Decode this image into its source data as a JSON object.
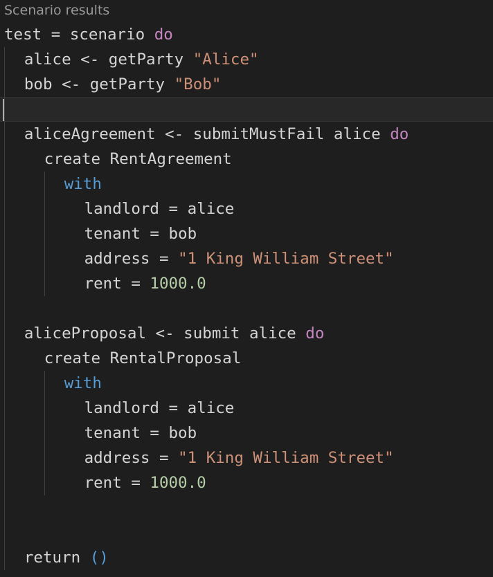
{
  "codelens": {
    "label": "Scenario results"
  },
  "lines": [
    {
      "indent": 0,
      "tokens": [
        {
          "t": "test = scenario ",
          "c": ""
        },
        {
          "t": "do",
          "c": "kw"
        }
      ]
    },
    {
      "indent": 1,
      "tokens": [
        {
          "t": "alice <- getParty ",
          "c": ""
        },
        {
          "t": "\"Alice\"",
          "c": "str"
        }
      ]
    },
    {
      "indent": 1,
      "tokens": [
        {
          "t": "bob <- getParty ",
          "c": ""
        },
        {
          "t": "\"Bob\"",
          "c": "str"
        }
      ]
    },
    {
      "indent": 0,
      "current": true,
      "tokens": []
    },
    {
      "indent": 1,
      "tokens": [
        {
          "t": "aliceAgreement <- submitMustFail alice ",
          "c": ""
        },
        {
          "t": "do",
          "c": "kw"
        }
      ]
    },
    {
      "indent": 2,
      "tokens": [
        {
          "t": "create RentAgreement",
          "c": ""
        }
      ]
    },
    {
      "indent": 3,
      "tokens": [
        {
          "t": "with",
          "c": "kw2"
        }
      ]
    },
    {
      "indent": 4,
      "tokens": [
        {
          "t": "landlord = alice",
          "c": ""
        }
      ]
    },
    {
      "indent": 4,
      "tokens": [
        {
          "t": "tenant = bob",
          "c": ""
        }
      ]
    },
    {
      "indent": 4,
      "tokens": [
        {
          "t": "address = ",
          "c": ""
        },
        {
          "t": "\"1 King William Street\"",
          "c": "str"
        }
      ]
    },
    {
      "indent": 4,
      "tokens": [
        {
          "t": "rent = ",
          "c": ""
        },
        {
          "t": "1000.0",
          "c": "num"
        }
      ]
    },
    {
      "indent": 0,
      "tokens": []
    },
    {
      "indent": 1,
      "tokens": [
        {
          "t": "aliceProposal <- submit alice ",
          "c": ""
        },
        {
          "t": "do",
          "c": "kw"
        }
      ]
    },
    {
      "indent": 2,
      "tokens": [
        {
          "t": "create RentalProposal",
          "c": ""
        }
      ]
    },
    {
      "indent": 3,
      "tokens": [
        {
          "t": "with",
          "c": "kw2"
        }
      ]
    },
    {
      "indent": 4,
      "tokens": [
        {
          "t": "landlord = alice",
          "c": ""
        }
      ]
    },
    {
      "indent": 4,
      "tokens": [
        {
          "t": "tenant = bob",
          "c": ""
        }
      ]
    },
    {
      "indent": 4,
      "tokens": [
        {
          "t": "address = ",
          "c": ""
        },
        {
          "t": "\"1 King William Street\"",
          "c": "str"
        }
      ]
    },
    {
      "indent": 4,
      "tokens": [
        {
          "t": "rent = ",
          "c": ""
        },
        {
          "t": "1000.0",
          "c": "num"
        }
      ]
    },
    {
      "indent": 0,
      "tokens": []
    },
    {
      "indent": 0,
      "tokens": []
    },
    {
      "indent": 1,
      "tokens": [
        {
          "t": "return ",
          "c": ""
        },
        {
          "t": "()",
          "c": "kw2"
        }
      ]
    }
  ],
  "colors": {
    "background": "#1e1e1e",
    "text": "#d4d4d4",
    "keyword": "#c586c0",
    "keyword_blue": "#569cd6",
    "string": "#ce9178",
    "number": "#b5cea8",
    "codelens": "#999999"
  }
}
